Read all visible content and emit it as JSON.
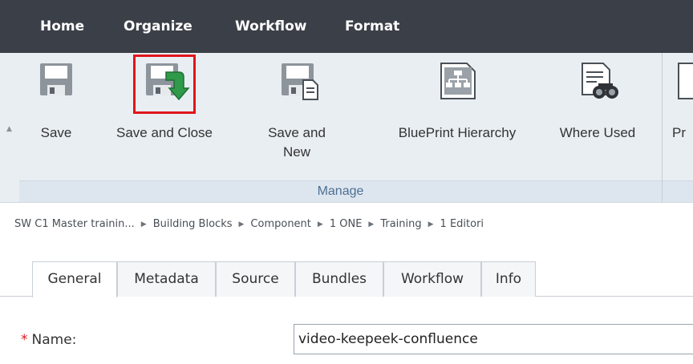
{
  "menu": {
    "tabs": [
      "Home",
      "Organize",
      "Workflow",
      "Format"
    ],
    "active": "Home"
  },
  "ribbon": {
    "buttons": {
      "save": "Save",
      "save_and_close": "Save and Close",
      "save_and_new_line1": "Save and",
      "save_and_new_line2": "New",
      "blueprint_hierarchy": "BluePrint Hierarchy",
      "where_used": "Where Used",
      "partial_next": "Pr"
    },
    "group_label": "Manage",
    "icons": [
      "save-icon",
      "save-and-close-icon",
      "save-and-new-icon",
      "blueprint-hierarchy-icon",
      "where-used-icon"
    ]
  },
  "breadcrumb": [
    "SW C1 Master trainin...",
    "Building Blocks",
    "Component",
    "1 ONE",
    "Training",
    "1 Editori"
  ],
  "tabs": [
    "General",
    "Metadata",
    "Source",
    "Bundles",
    "Workflow",
    "Info"
  ],
  "active_tab": "General",
  "form": {
    "required_marker": "*",
    "name_label": "Name:",
    "name_value": "video-keepeek-confluence"
  },
  "colors": {
    "menubar": "#3b4048",
    "ribbon": "#e9eef3",
    "highlight": "#e0161b",
    "green_arrow": "#2f9a4a"
  }
}
